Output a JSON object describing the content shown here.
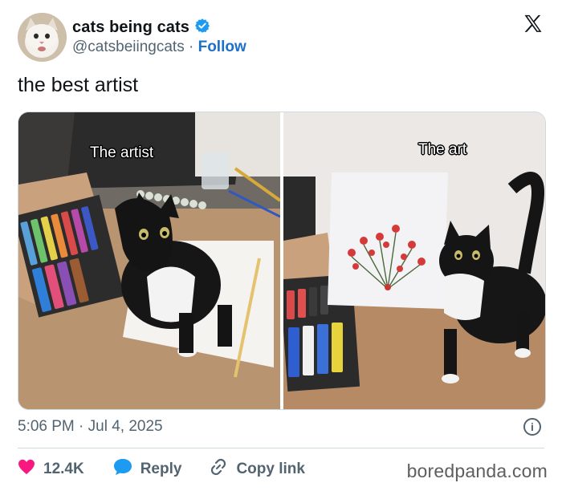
{
  "author": {
    "display_name": "cats being cats",
    "handle": "@catsbeiingcats",
    "separator": "·",
    "follow_label": "Follow",
    "verified_color": "#1d9bf0"
  },
  "tweet": {
    "text": "the best artist",
    "media": [
      {
        "caption": "The artist"
      },
      {
        "caption": "The art"
      }
    ],
    "time": "5:06 PM",
    "date_separator": "·",
    "date": "Jul 4, 2025"
  },
  "actions": {
    "like_count": "12.4K",
    "reply_label": "Reply",
    "copy_link_label": "Copy link"
  },
  "icons": {
    "like": "heart-icon",
    "reply": "speech-bubble-icon",
    "copy_link": "link-icon",
    "info": "info-icon",
    "platform": "x-logo-icon"
  },
  "colors": {
    "heart": "#f91880",
    "reply": "#1d9bf0",
    "follow": "#1d70c8"
  },
  "watermark": "boredpanda.com"
}
